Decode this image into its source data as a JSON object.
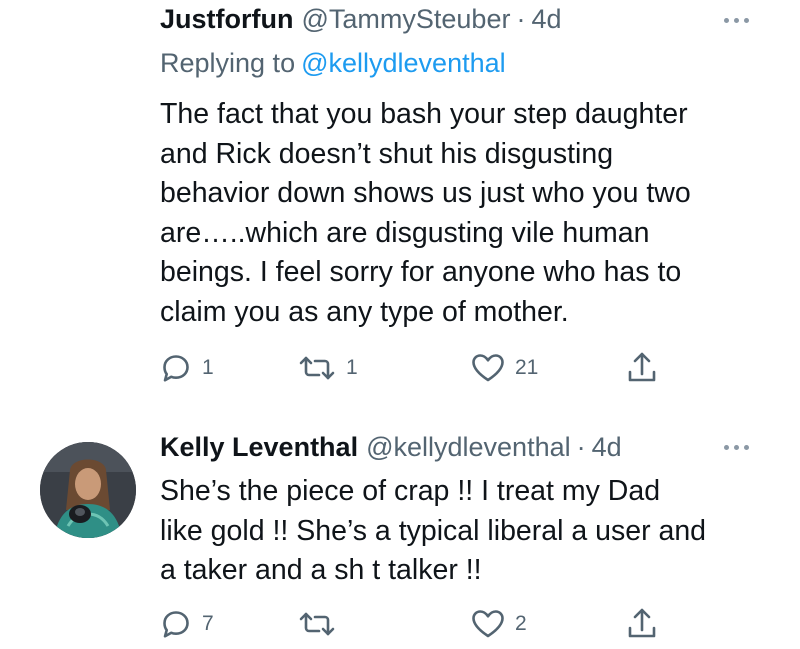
{
  "tweets": [
    {
      "display_name": "Justforfun",
      "handle": "@TammySteuber",
      "separator": "·",
      "time": "4d",
      "replying_prefix": "Replying to",
      "replying_handle": "@kellydleventhal",
      "lines": [
        "The fact that you bash your step daughter",
        "and Rick doesn’t shut his disgusting",
        "behavior down shows us just who you two",
        "are…..which are disgusting vile human",
        "beings. I feel sorry for anyone who has to",
        "claim you as any type of mother."
      ],
      "actions": {
        "replies": "1",
        "retweets": "1",
        "likes": "21"
      }
    },
    {
      "display_name": "Kelly Leventhal",
      "handle": "@kellydleventhal",
      "separator": "·",
      "time": "4d",
      "lines": [
        "She’s the piece of crap !! I treat my Dad",
        "like gold !! She’s a typical liberal a user and",
        "a taker and a sh t talker !!"
      ],
      "actions": {
        "replies": "7",
        "retweets": "",
        "likes": "2"
      }
    }
  ],
  "icons": {
    "reply": "reply-icon",
    "retweet": "retweet-icon",
    "like": "heart-icon",
    "share": "share-icon",
    "more": "more-icon"
  },
  "colors": {
    "text": "#0f1419",
    "secondary": "#536471",
    "link": "#1d9bf0",
    "icon": "#536471"
  }
}
